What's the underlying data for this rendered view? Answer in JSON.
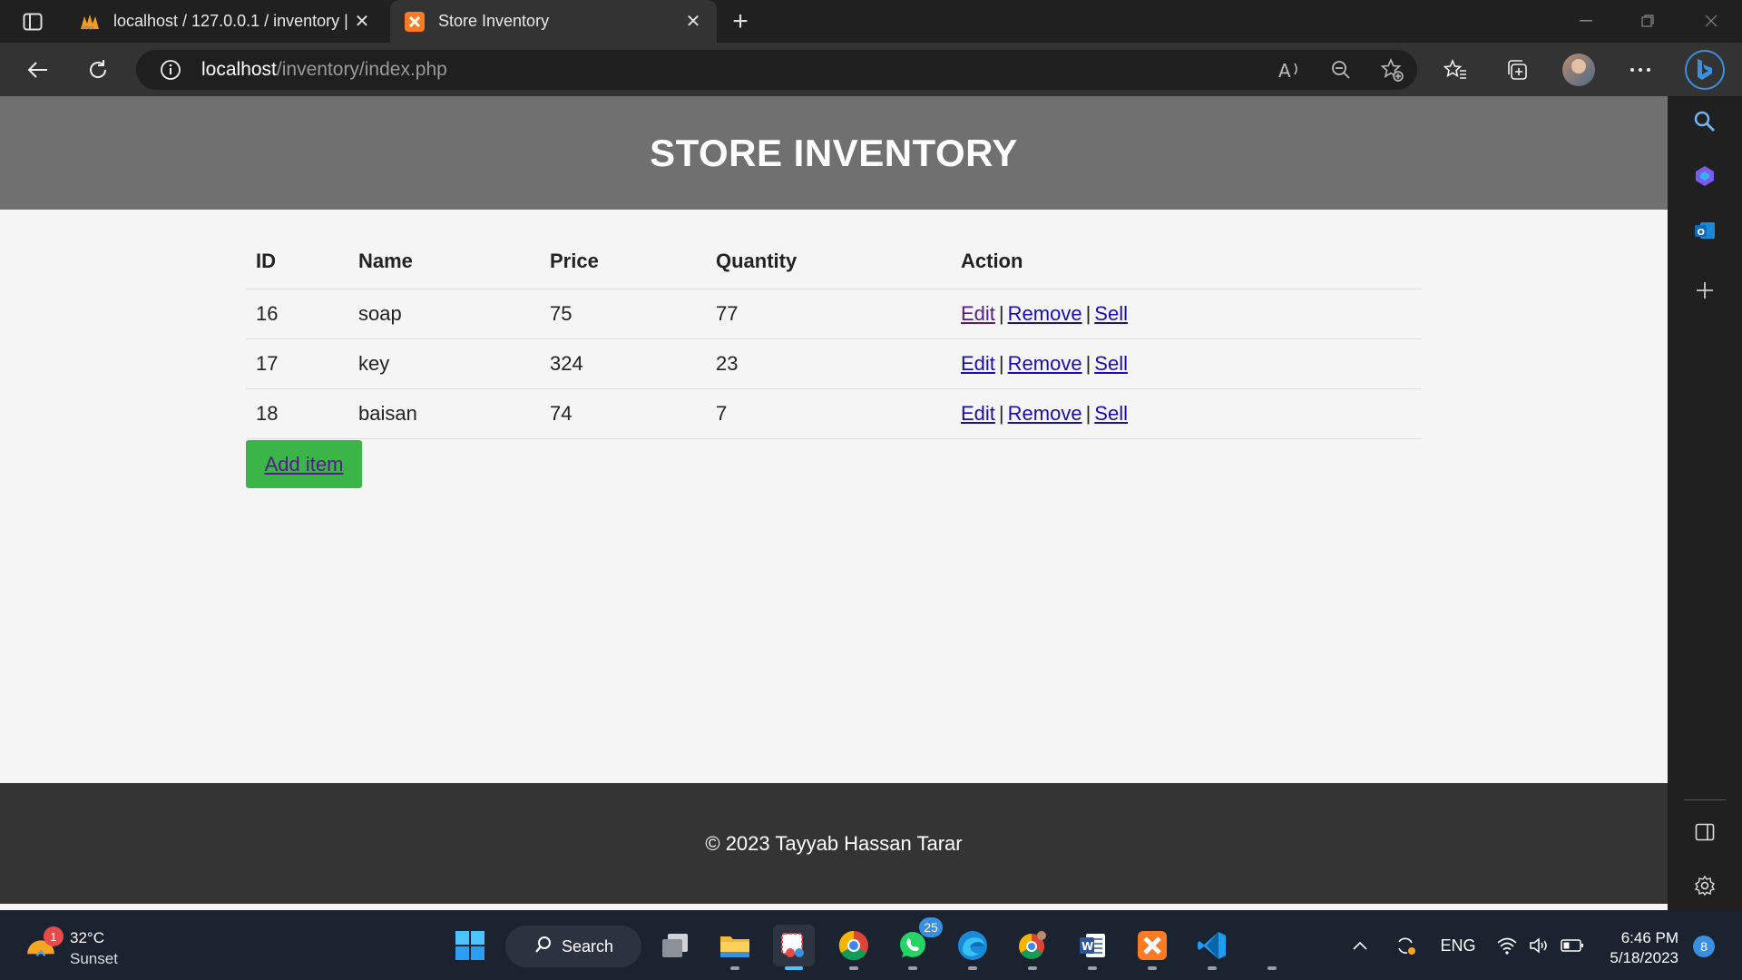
{
  "browser": {
    "tabs": [
      {
        "title": "localhost / 127.0.0.1 / inventory |",
        "active": false,
        "icon": "phpmyadmin-icon"
      },
      {
        "title": "Store Inventory",
        "active": true,
        "icon": "xampp-icon"
      }
    ],
    "url": {
      "host": "localhost",
      "path": "/inventory/index.php"
    }
  },
  "page": {
    "header_title": "STORE INVENTORY",
    "table": {
      "headers": [
        "ID",
        "Name",
        "Price",
        "Quantity",
        "Action"
      ],
      "rows": [
        {
          "id": "16",
          "name": "soap",
          "price": "75",
          "quantity": "77"
        },
        {
          "id": "17",
          "name": "key",
          "price": "324",
          "quantity": "23"
        },
        {
          "id": "18",
          "name": "baisan",
          "price": "74",
          "quantity": "7"
        }
      ],
      "actions": {
        "edit": "Edit",
        "remove": "Remove",
        "sell": "Sell",
        "separator": "|"
      }
    },
    "add_button": "Add item",
    "footer": "© 2023 Tayyab Hassan Tarar"
  },
  "taskbar": {
    "weather": {
      "temp": "32°C",
      "condition": "Sunset",
      "badge": "1"
    },
    "search_label": "Search",
    "whatsapp_badge": "25",
    "language": "ENG",
    "time": "6:46 PM",
    "date": "5/18/2023",
    "notification_count": "8"
  },
  "colors": {
    "page_header": "#707070",
    "page_footer": "#343434",
    "add_button": "#3cb548",
    "link": "#1a0dab",
    "visited_link": "#551a8b"
  }
}
